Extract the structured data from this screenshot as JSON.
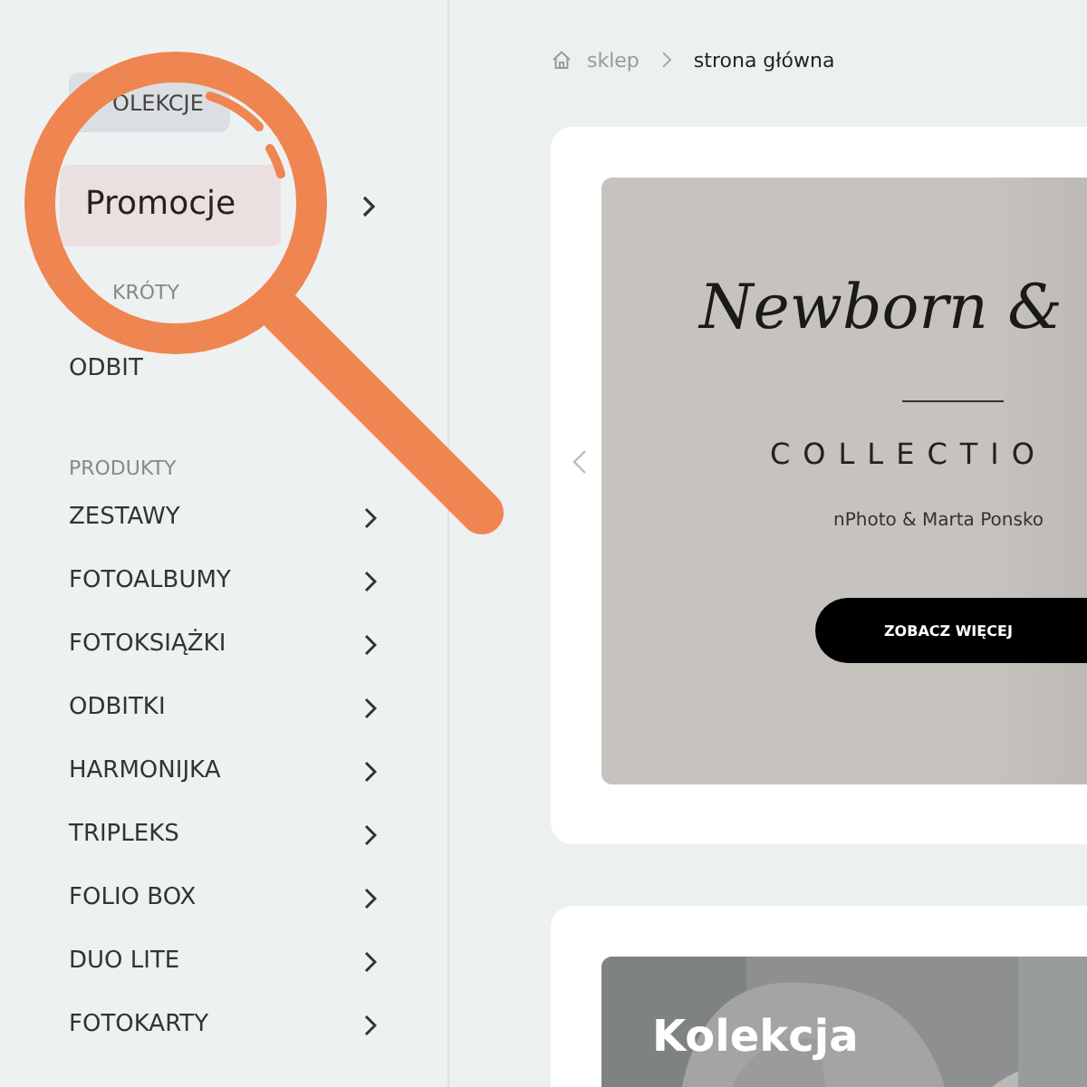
{
  "sidebar": {
    "collections_chip": "OLEKCJE",
    "promo": {
      "label": "Promocje",
      "has_arrow": true
    },
    "sections": [
      {
        "title": "KRÓTY",
        "items": [
          {
            "label": "ODBIT",
            "has_arrow": false
          }
        ]
      },
      {
        "title": "PRODUKTY",
        "items": [
          {
            "label": "ZESTAWY",
            "has_arrow": true
          },
          {
            "label": "FOTOALBUMY",
            "has_arrow": true
          },
          {
            "label": "FOTOKSIĄŻKI",
            "has_arrow": true
          },
          {
            "label": "ODBITKI",
            "has_arrow": true
          },
          {
            "label": "HARMONIJKA",
            "has_arrow": true
          },
          {
            "label": "TRIPLEKS",
            "has_arrow": true
          },
          {
            "label": "FOLIO BOX",
            "has_arrow": true
          },
          {
            "label": "DUO LITE",
            "has_arrow": true
          },
          {
            "label": "FOTOKARTY",
            "has_arrow": true
          }
        ]
      }
    ]
  },
  "breadcrumb": [
    {
      "label": "sklep",
      "current": false
    },
    {
      "label": "strona główna",
      "current": true
    }
  ],
  "hero": {
    "script_title": "Newborn &",
    "subtitle": "COLLECTIO",
    "credit": "nPhoto & Marta Ponsko",
    "button": "ZOBACZ WIĘCEJ"
  },
  "second_banner": {
    "kind": "picture",
    "title": "Kolekcja"
  }
}
